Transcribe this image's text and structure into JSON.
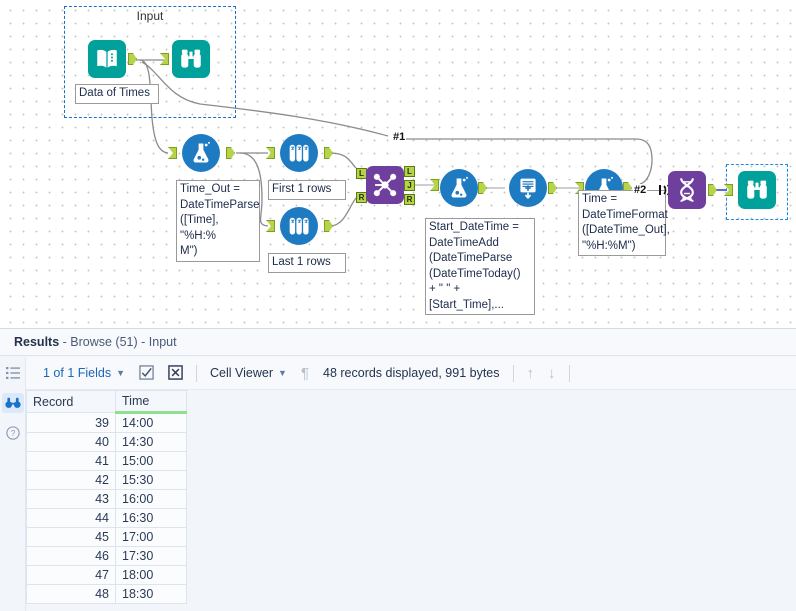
{
  "canvas": {
    "container": {
      "title": "Input"
    },
    "tools": [
      {
        "id": "input-data",
        "name": "input-data-tool",
        "icon": "book-icon"
      },
      {
        "id": "browse-top",
        "name": "browse-tool",
        "icon": "binoculars-icon"
      },
      {
        "id": "formula-1",
        "name": "formula-tool",
        "icon": "flask-icon"
      },
      {
        "id": "sample-first",
        "name": "sample-tool-first",
        "icon": "test-tubes-icon"
      },
      {
        "id": "sample-last",
        "name": "sample-tool-last",
        "icon": "test-tubes-icon"
      },
      {
        "id": "join",
        "name": "join-tool",
        "icon": "join-icon"
      },
      {
        "id": "formula-2",
        "name": "formula-tool",
        "icon": "flask-icon"
      },
      {
        "id": "generate",
        "name": "generate-rows-tool",
        "icon": "generate-rows-icon"
      },
      {
        "id": "formula-3",
        "name": "formula-tool",
        "icon": "flask-icon"
      },
      {
        "id": "multirow",
        "name": "multi-row-formula-tool",
        "icon": "helix-icon"
      },
      {
        "id": "browse-end",
        "name": "browse-tool",
        "icon": "binoculars-icon"
      }
    ],
    "annotations": {
      "input_label": "Data of Times",
      "formula1": "Time_Out =\nDateTimeParse\n([Time], \"%H:%\nM\")",
      "sample_first": "First 1 rows",
      "sample_last": "Last 1 rows",
      "formula2": "Start_DateTime =\nDateTimeAdd\n(DateTimeParse\n(DateTimeToday()\n+ \" \" +\n[Start_Time],...",
      "formula3": "Time =\nDateTimeFormat\n([DateTime_Out],\n\"%H:%M\")"
    },
    "join_anchors": {
      "in_left": "L",
      "in_right": "R",
      "out_left": "L",
      "out_join": "J",
      "out_right": "R"
    },
    "wire_labels": {
      "one": "#1",
      "two": "#2"
    }
  },
  "results": {
    "header": {
      "title": "Results",
      "subtitle": "- Browse (51) - Input"
    },
    "rail": [
      {
        "name": "sidebar-item-list",
        "icon": "list-icon",
        "active": false
      },
      {
        "name": "sidebar-item-browse",
        "icon": "binoculars-icon",
        "active": true
      },
      {
        "name": "sidebar-item-help",
        "icon": "help-icon",
        "active": false
      }
    ],
    "toolbar": {
      "fields_label": "1 of 1 Fields",
      "select_all_icon": "checkbox-icon",
      "deselect_all_icon": "close-box-icon",
      "view_label": "Cell Viewer",
      "pilcrow_icon": "pilcrow-icon",
      "status": "48 records displayed, 991 bytes",
      "up_icon": "arrow-up-icon",
      "down_icon": "arrow-down-icon"
    },
    "grid": {
      "columns": [
        "Record",
        "Time"
      ],
      "rows": [
        [
          "39",
          "14:00"
        ],
        [
          "40",
          "14:30"
        ],
        [
          "41",
          "15:00"
        ],
        [
          "42",
          "15:30"
        ],
        [
          "43",
          "16:00"
        ],
        [
          "44",
          "16:30"
        ],
        [
          "45",
          "17:00"
        ],
        [
          "46",
          "17:30"
        ],
        [
          "47",
          "18:00"
        ],
        [
          "48",
          "18:30"
        ]
      ]
    }
  },
  "colors": {
    "teal": "#00a09b",
    "blue": "#1f7bc1",
    "purple": "#6f3f9e",
    "anchor_green": "#b5d44a",
    "accent_link": "#1a66b8",
    "sorted_underline": "#8fe08f"
  }
}
